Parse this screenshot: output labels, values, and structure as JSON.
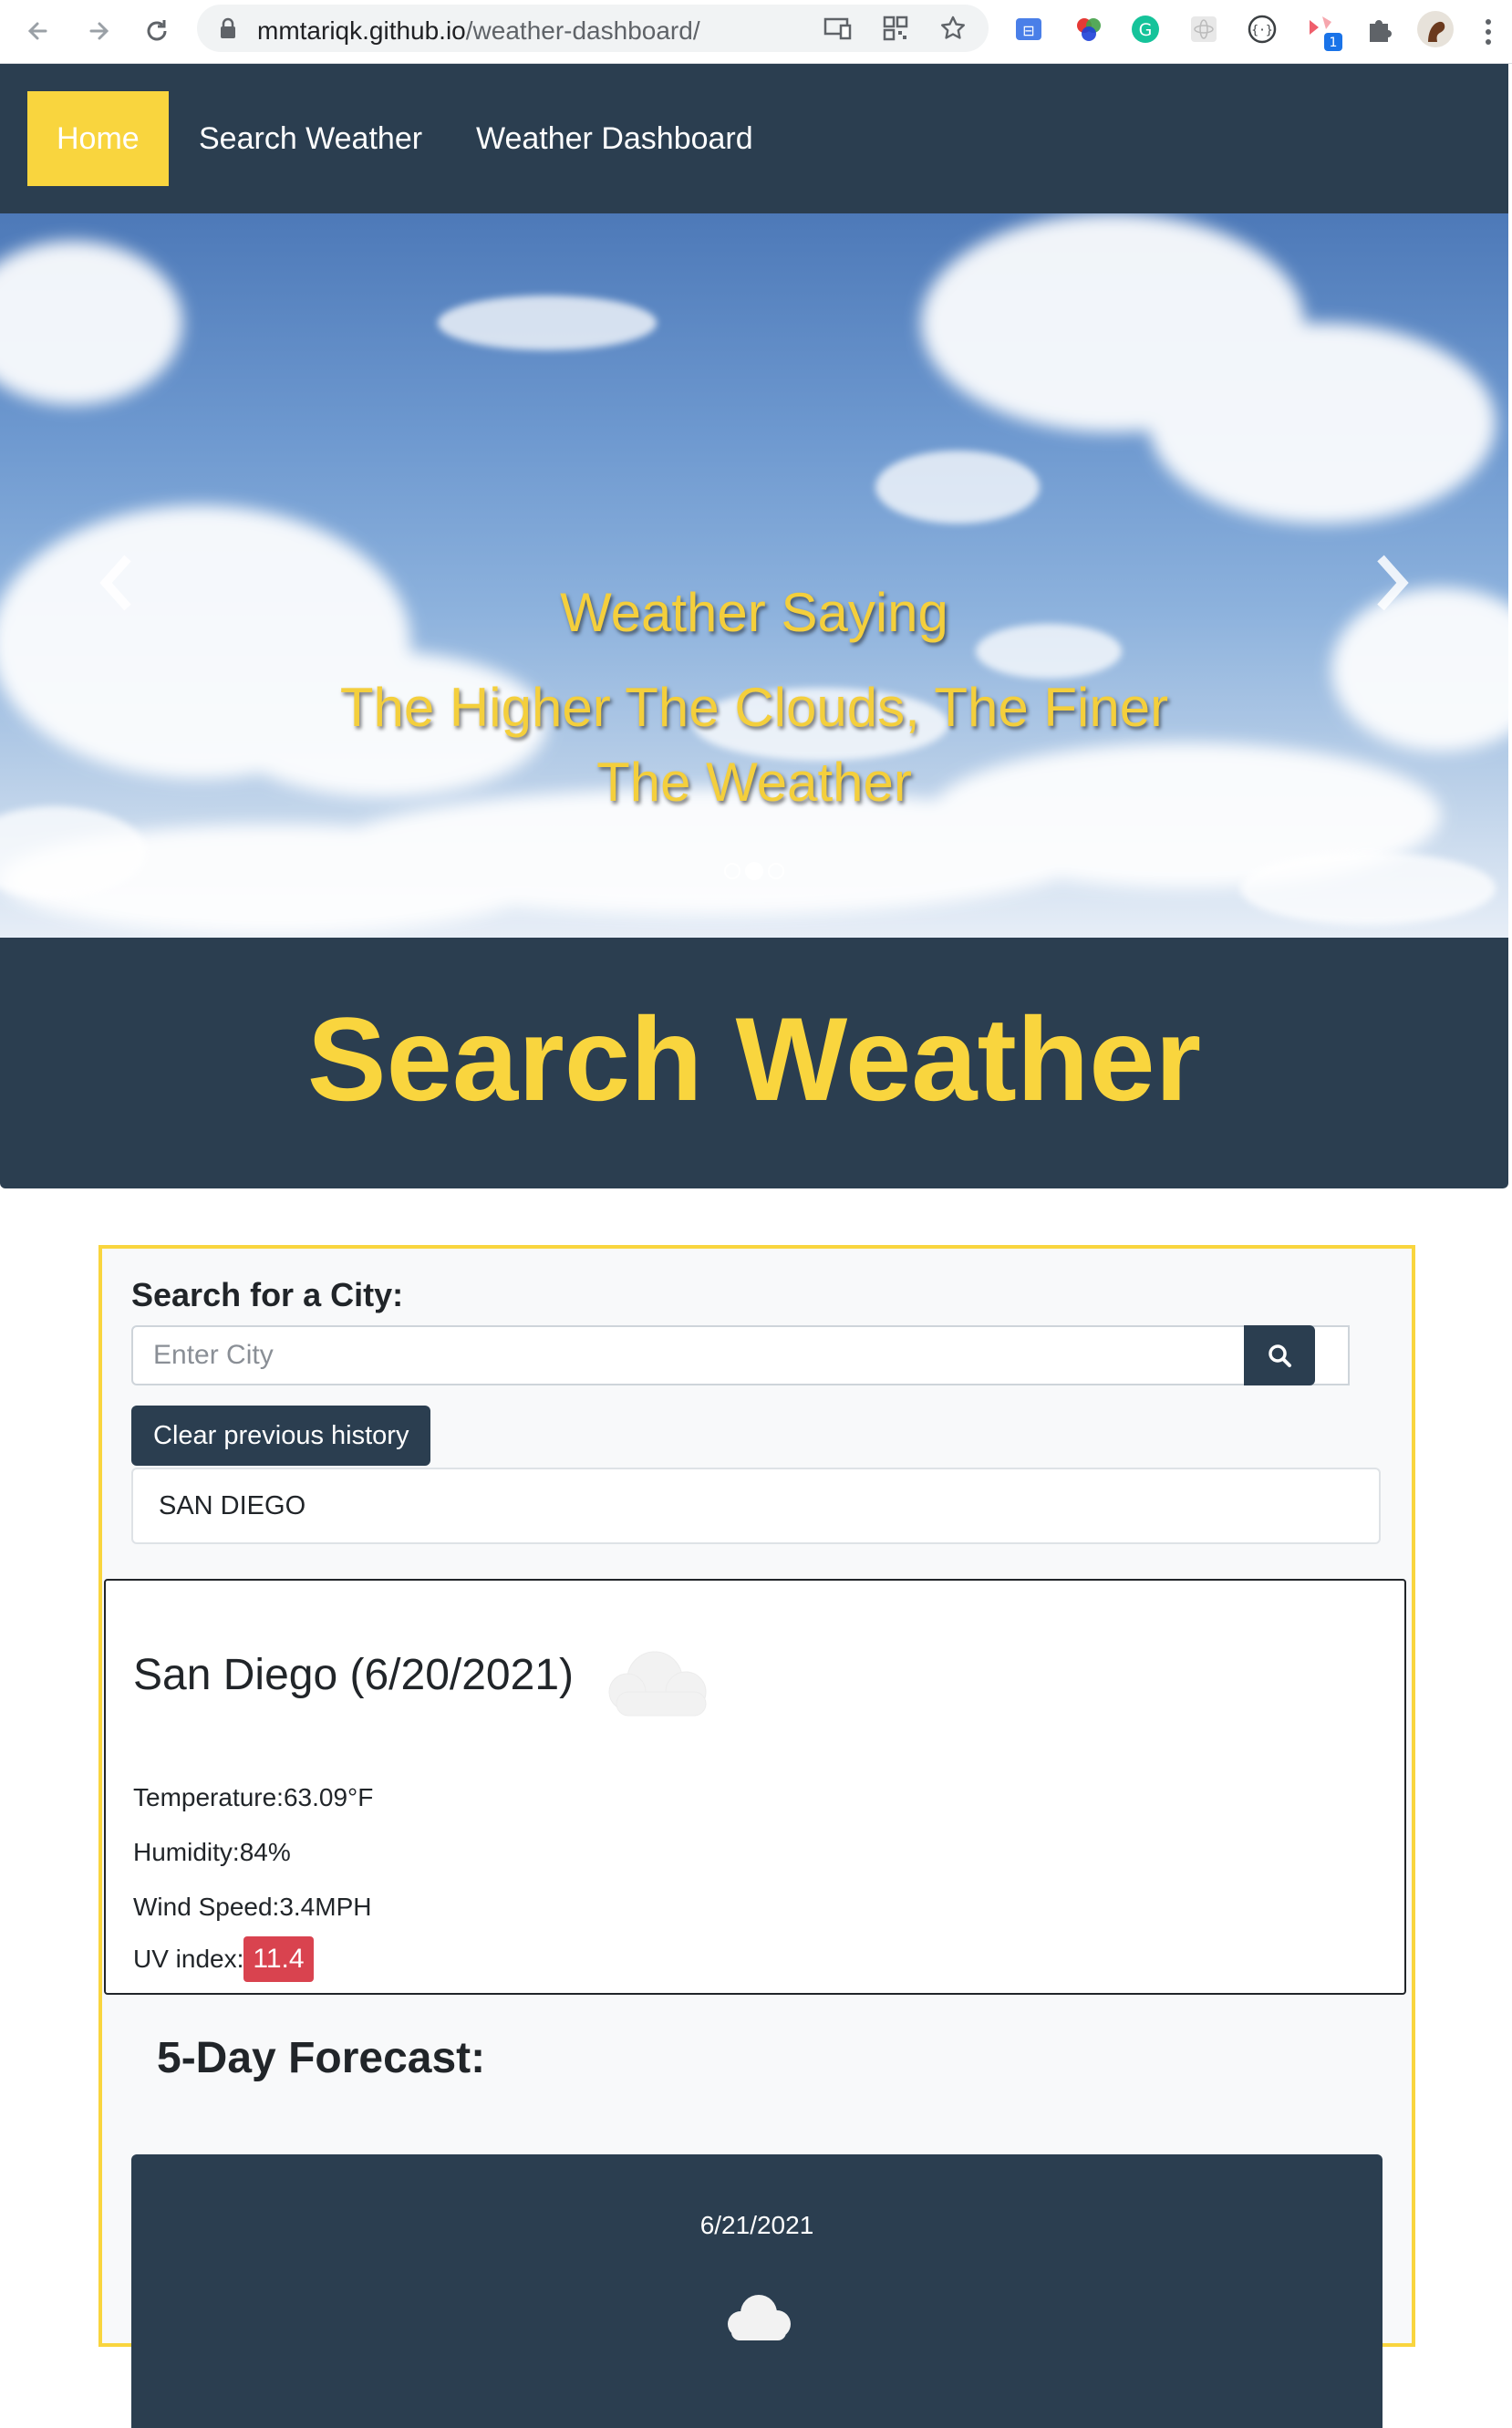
{
  "browser": {
    "url_host": "mmtariqk.github.io",
    "url_path": "/weather-dashboard/",
    "back_icon": "arrow-left-icon",
    "forward_icon": "arrow-right-icon",
    "reload_icon": "reload-icon",
    "lock_icon": "lock-icon",
    "extension_badge": "1"
  },
  "navbar": {
    "items": [
      {
        "label": "Home",
        "active": true
      },
      {
        "label": "Search Weather",
        "active": false
      },
      {
        "label": "Weather Dashboard",
        "active": false
      }
    ]
  },
  "hero": {
    "line1": "Weather Saying",
    "line2": "The Higher The Clouds, The Finer",
    "line3": "The Weather",
    "active_slide": 2,
    "slide_count": 3
  },
  "section": {
    "title": "Search Weather"
  },
  "search": {
    "label": "Search for a City:",
    "placeholder": "Enter City",
    "clear_label": "Clear previous history",
    "history": [
      "SAN DIEGO"
    ]
  },
  "current": {
    "title": "San Diego (6/20/2021)",
    "temperature": "Temperature:63.09°F",
    "humidity": "Humidity:84%",
    "wind": "Wind Speed:3.4MPH",
    "uv_label": "UV index:",
    "uv_value": "11.4",
    "uv_color": "#d9434f",
    "icon": "cloud-icon"
  },
  "forecast": {
    "title": "5-Day Forecast:",
    "days": [
      {
        "date": "6/21/2021",
        "icon": "cloud-icon"
      }
    ]
  },
  "colors": {
    "navy": "#2b3e50",
    "accent": "#f9d53e"
  }
}
